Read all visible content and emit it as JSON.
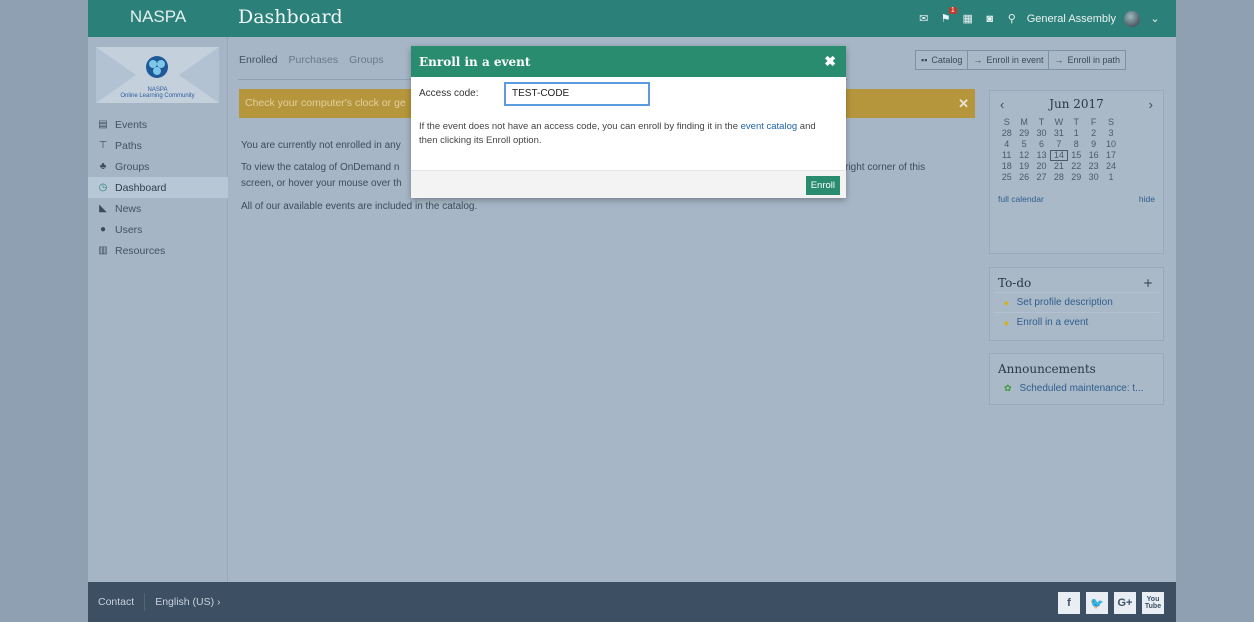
{
  "topbar": {
    "brand": "NASPA",
    "title": "Dashboard",
    "notification_count": "1",
    "user_name": "General Assembly",
    "icons": [
      "mail-icon",
      "notifications-icon",
      "calendar-icon",
      "help-icon",
      "search-icon",
      "chevron-down-icon"
    ]
  },
  "logo": {
    "line1": "NASPA",
    "line2": "Online Learning Community"
  },
  "sidebar": {
    "items": [
      {
        "label": "Events",
        "icon": "events-icon"
      },
      {
        "label": "Paths",
        "icon": "paths-icon"
      },
      {
        "label": "Groups",
        "icon": "groups-icon"
      },
      {
        "label": "Dashboard",
        "icon": "dashboard-icon"
      },
      {
        "label": "News",
        "icon": "news-icon"
      },
      {
        "label": "Users",
        "icon": "users-icon"
      },
      {
        "label": "Resources",
        "icon": "resources-icon"
      }
    ],
    "active_index": 3
  },
  "tabs": [
    "Enrolled",
    "Purchases",
    "Groups"
  ],
  "breadcrumbs": {
    "catalog": "Catalog",
    "enroll_event": "Enroll in event",
    "enroll_path": "Enroll in path"
  },
  "warning": {
    "text": "Check your computer's clock or ge"
  },
  "messages": {
    "line1": "You are currently not enrolled in any",
    "line2a": "To view the catalog of OnDemand n",
    "line2b": "r right corner of this",
    "line3": "screen, or hover your mouse over th",
    "line4": "All of our available events are included in the catalog."
  },
  "calendar": {
    "month": "Jun 2017",
    "weekdays": [
      "S",
      "M",
      "T",
      "W",
      "T",
      "F",
      "S"
    ],
    "weeks": [
      [
        "28",
        "29",
        "30",
        "31",
        "1",
        "2",
        "3"
      ],
      [
        "4",
        "5",
        "6",
        "7",
        "8",
        "9",
        "10"
      ],
      [
        "11",
        "12",
        "13",
        "14",
        "15",
        "16",
        "17"
      ],
      [
        "18",
        "19",
        "20",
        "21",
        "22",
        "23",
        "24"
      ],
      [
        "25",
        "26",
        "27",
        "28",
        "29",
        "30",
        "1"
      ]
    ],
    "today": "14",
    "full_calendar": "full calendar",
    "hide": "hide"
  },
  "todo": {
    "title": "To-do",
    "items": [
      "Set profile description",
      "Enroll in a event"
    ]
  },
  "announcements": {
    "title": "Announcements",
    "items": [
      "Scheduled maintenance: t..."
    ]
  },
  "footer": {
    "contact": "Contact",
    "language": "English (US)",
    "social": [
      "f",
      "t",
      "G+",
      "You Tube"
    ]
  },
  "modal": {
    "title": "Enroll in a event",
    "access_label": "Access code:",
    "access_value": "TEST-CODE",
    "note_before": "If the event does not have an access code, you can enroll by finding it in the ",
    "note_link": "event catalog",
    "note_after": " and then clicking its Enroll option.",
    "enroll_button": "Enroll"
  }
}
